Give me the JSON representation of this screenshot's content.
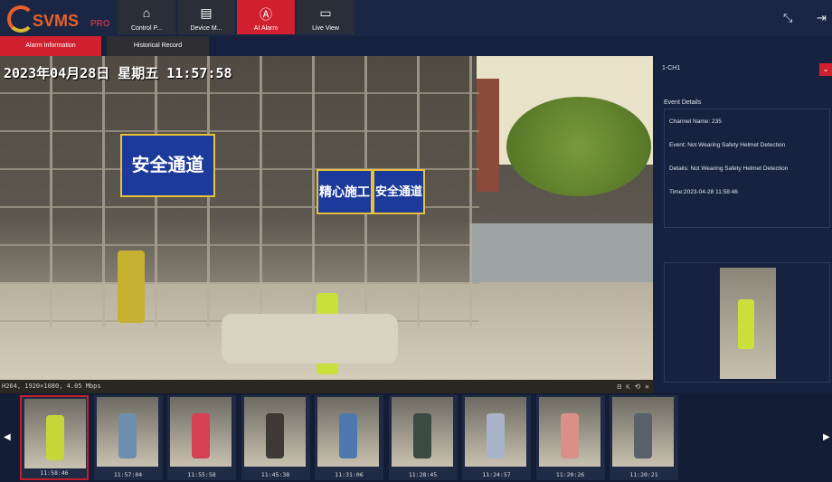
{
  "app": {
    "logo_text": "SVMS",
    "logo_suffix": "PRO"
  },
  "nav": [
    {
      "label": "Control P...",
      "icon": "home-icon",
      "glyph": "⌂"
    },
    {
      "label": "Device M...",
      "icon": "device-icon",
      "glyph": "▤"
    },
    {
      "label": "AI Alarm",
      "icon": "ai-icon",
      "glyph": "Ⓐ"
    },
    {
      "label": "Live View",
      "icon": "camera-icon",
      "glyph": "▭"
    }
  ],
  "top_right": {
    "exit_fullscreen": "⤡",
    "logout": "⇥"
  },
  "subtabs": [
    {
      "label": "Alarm Information"
    },
    {
      "label": "Historical Record"
    }
  ],
  "video": {
    "osd": "2023年04月28日 星期五 11:57:58",
    "signs": [
      "安全通道",
      "精心施工",
      "安全通道"
    ],
    "info": "H264, 1920×1080, 4.05 Mbps",
    "controls": "⊟ ⇱ ⟲ ✕"
  },
  "panel": {
    "channel": "1-CH1",
    "dropdown": "⌄",
    "event_details_title": "Event Details",
    "channel_name": "Channel Name: 235",
    "event": "Event: Not Wearing Safety Helmet Detection",
    "details": "Details: Not Wearing Safety Helmet Detection",
    "time": "Time:2023-04-28 11:58:46"
  },
  "thumbnails": [
    {
      "time": "11:58:46",
      "selected": true,
      "color": "#c6d63a"
    },
    {
      "time": "11:57:04",
      "color": "#6c8fb0"
    },
    {
      "time": "11:55:58",
      "color": "#d34050"
    },
    {
      "time": "11:45:38",
      "color": "#3d3a36"
    },
    {
      "time": "11:31:06",
      "color": "#4f78b0"
    },
    {
      "time": "11:28:45",
      "color": "#3c4a44"
    },
    {
      "time": "11:24:57",
      "color": "#a8b4c8"
    },
    {
      "time": "11:20:26",
      "color": "#d89088"
    },
    {
      "time": "11:20:21",
      "color": "#58606a"
    }
  ],
  "colors": {
    "accent": "#d0202f",
    "background": "#15213d"
  }
}
